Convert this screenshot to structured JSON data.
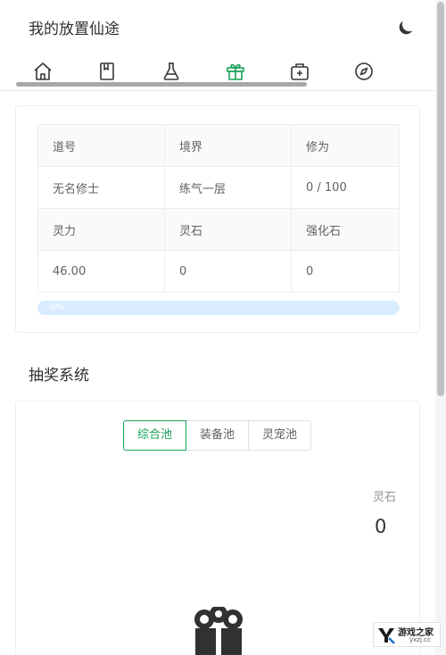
{
  "header": {
    "title": "我的放置仙途",
    "theme_icon": "moon-icon"
  },
  "nav": {
    "items": [
      {
        "icon": "home-icon",
        "active": false
      },
      {
        "icon": "book-icon",
        "active": false
      },
      {
        "icon": "flask-icon",
        "active": false
      },
      {
        "icon": "gift-icon",
        "active": true
      },
      {
        "icon": "medkit-icon",
        "active": false
      },
      {
        "icon": "compass-icon",
        "active": false
      }
    ],
    "active_color": "#18a058",
    "inactive_color": "#333639"
  },
  "stats": {
    "headers_row1": [
      "道号",
      "境界",
      "修为"
    ],
    "values_row1": [
      "无名修士",
      "练气一层",
      "0 / 100"
    ],
    "headers_row2": [
      "灵力",
      "灵石",
      "强化石"
    ],
    "values_row2": [
      "46.00",
      "0",
      "0"
    ],
    "progress_text": "0%",
    "progress_value": 0
  },
  "lottery": {
    "section_title": "抽奖系统",
    "tabs": [
      "综合池",
      "装备池",
      "灵宠池"
    ],
    "active_tab": 0,
    "stone_label": "灵石",
    "stone_value": "0",
    "icon": "gift-icon"
  },
  "watermark": {
    "name": "游戏之家",
    "domain": "yxzj.cc"
  }
}
